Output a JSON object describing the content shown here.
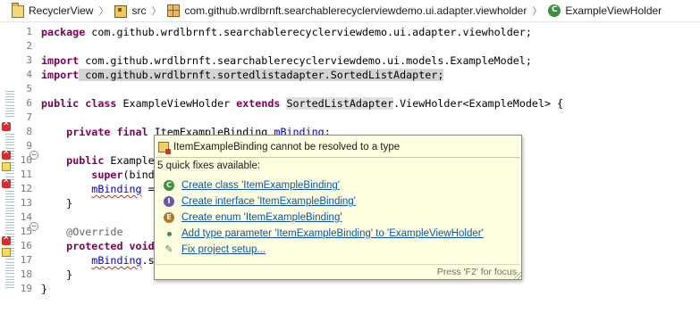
{
  "breadcrumb": [
    {
      "label": "RecyclerView",
      "icon": "project-icon"
    },
    {
      "label": "src",
      "icon": "source-folder-icon"
    },
    {
      "label": "com.github.wrdlbrnft.searchablerecyclerviewdemo.ui.adapter.viewholder",
      "icon": "package-icon"
    },
    {
      "label": "ExampleViewHolder",
      "icon": "class-icon"
    }
  ],
  "editor": {
    "line_numbers": [
      "1",
      "2",
      "3",
      "4",
      "5",
      "6",
      "7",
      "8",
      "9",
      "10",
      "11",
      "12",
      "13",
      "14",
      "15",
      "16",
      "17",
      "18",
      "19"
    ],
    "code": {
      "l1_kw": "package",
      "l1_rest": " com.github.wrdlbrnft.searchablerecyclerviewdemo.ui.adapter.viewholder;",
      "l3_kw": "import",
      "l3_rest": " com.github.wrdlbrnft.searchablerecyclerviewdemo.ui.models.ExampleModel;",
      "l4_kw": "import",
      "l4_rest": " com.github.wrdlbrnft.sortedlistadapter.SortedListAdapter",
      "l4_end": ";",
      "l6_kw1": "public",
      "l6_kw2": "class",
      "l6_name": " ExampleViewHolder ",
      "l6_kw3": "extends",
      "l6_super": "SortedListAdapter",
      "l6_rest": ".ViewHolder<ExampleModel> {",
      "l8_kw": "private final",
      "l8_type": "ItemExampleBinding",
      "l8_field": "mBinding",
      "l8_end": ";",
      "l10_kw": "public",
      "l10_rest": " Example",
      "l11_kw": "super",
      "l11_rest": "(bind",
      "l12_field": "mBinding",
      "l12_rest": " =",
      "l13": "    }",
      "l15": "@Override",
      "l16_kw": "protected void",
      "l17_field": "mBinding",
      "l17_rest": ".s",
      "l18": "    }",
      "l19": "}"
    }
  },
  "quickfix": {
    "title": "ItemExampleBinding cannot be resolved to a type",
    "count_label": "5 quick fixes available:",
    "fixes": [
      {
        "label": "Create class 'ItemExampleBinding'",
        "icon": "class-icon"
      },
      {
        "label": "Create interface 'ItemExampleBinding'",
        "icon": "interface-icon"
      },
      {
        "label": "Create enum 'ItemExampleBinding'",
        "icon": "enum-icon"
      },
      {
        "label": "Add type parameter 'ItemExampleBinding' to 'ExampleViewHolder'",
        "icon": "type-parameter-icon"
      },
      {
        "label": "Fix project setup...",
        "icon": "wrench-icon"
      }
    ],
    "footer": "Press 'F2' for focus"
  },
  "icons": {
    "class_letter": "C",
    "interface_letter": "I",
    "enum_letter": "E",
    "wrench_glyph": "✎",
    "fold_minus": "−",
    "breadcrumb_separator": "〉"
  },
  "colors": {
    "keyword": "#7f0055",
    "field": "#0000c0",
    "link": "#0b53ad",
    "popup_bg": "#ffffe1",
    "error": "#d03030"
  }
}
